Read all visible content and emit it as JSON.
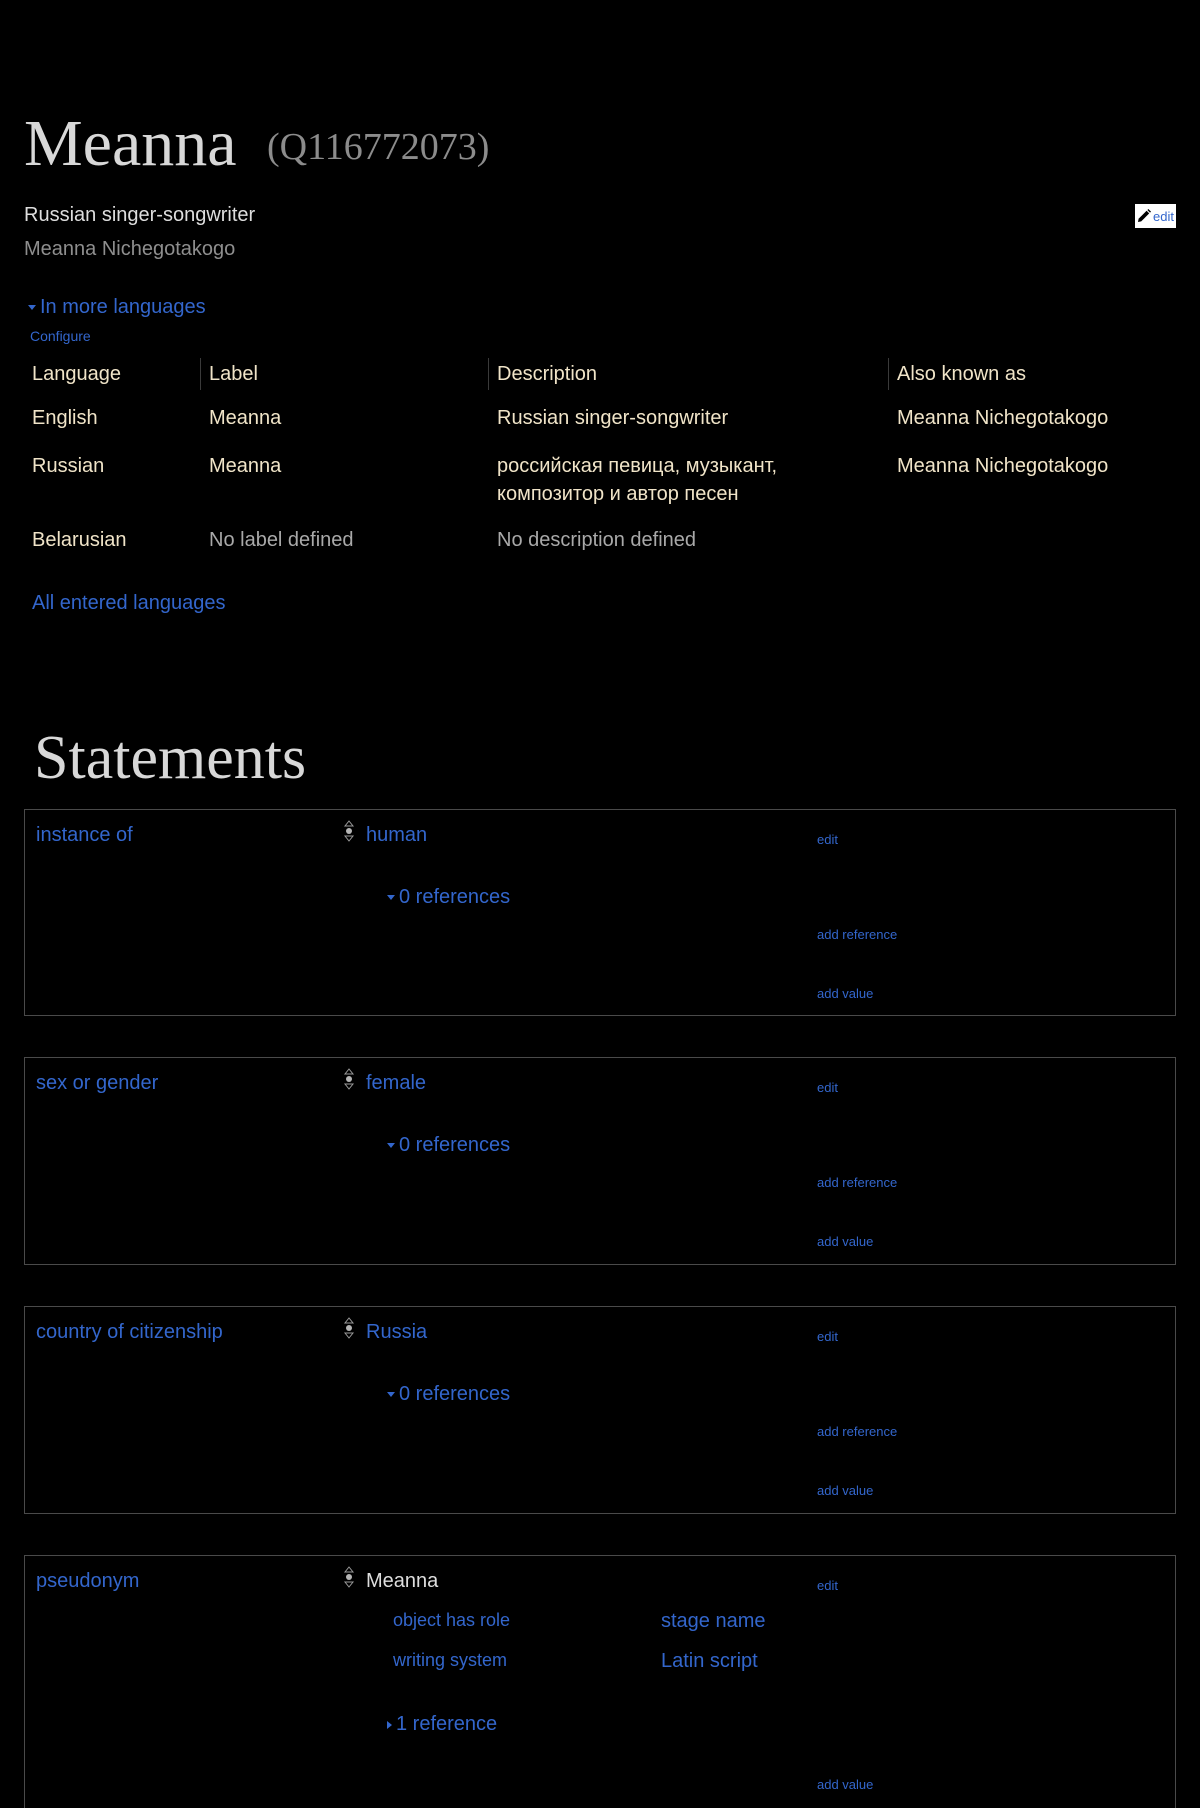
{
  "entity": {
    "label": "Meanna",
    "id": "(Q116772073)",
    "description": "Russian singer-songwriter",
    "alias": "Meanna Nichegotakogo",
    "edit_label": "edit"
  },
  "languages": {
    "toggle_label": "In more languages",
    "configure_label": "Configure",
    "headers": [
      "Language",
      "Label",
      "Description",
      "Also known as"
    ],
    "rows": [
      {
        "language": "English",
        "label": "Meanna",
        "description": "Russian singer-songwriter",
        "aliases": "Meanna Nichegotakogo"
      },
      {
        "language": "Russian",
        "label": "Meanna",
        "description": "российская певица, музыкант, композитор и автор песен",
        "aliases": "Meanna Nichegotakogo"
      },
      {
        "language": "Belarusian",
        "label": "No label defined",
        "description": "No description defined",
        "aliases": ""
      }
    ],
    "all_languages_label": "All entered languages"
  },
  "statements": {
    "title": "Statements",
    "edit_label": "edit",
    "add_reference_label": "add reference",
    "add_value_label": "add value",
    "groups": [
      {
        "property": "instance of",
        "value": "human",
        "references": "0 references"
      },
      {
        "property": "sex or gender",
        "value": "female",
        "references": "0 references"
      },
      {
        "property": "country of citizenship",
        "value": "Russia",
        "references": "0 references"
      },
      {
        "property": "pseudonym",
        "value": "Meanna",
        "qualifiers": [
          {
            "property": "object has role",
            "value": "stage name"
          },
          {
            "property": "writing system",
            "value": "Latin script"
          }
        ],
        "references": "1 reference"
      }
    ]
  },
  "colors": {
    "background": "#000000",
    "link": "#3366cc",
    "table_text": "#f0e4c8",
    "muted": "#8e8e8e",
    "border": "#4a4a4a"
  }
}
